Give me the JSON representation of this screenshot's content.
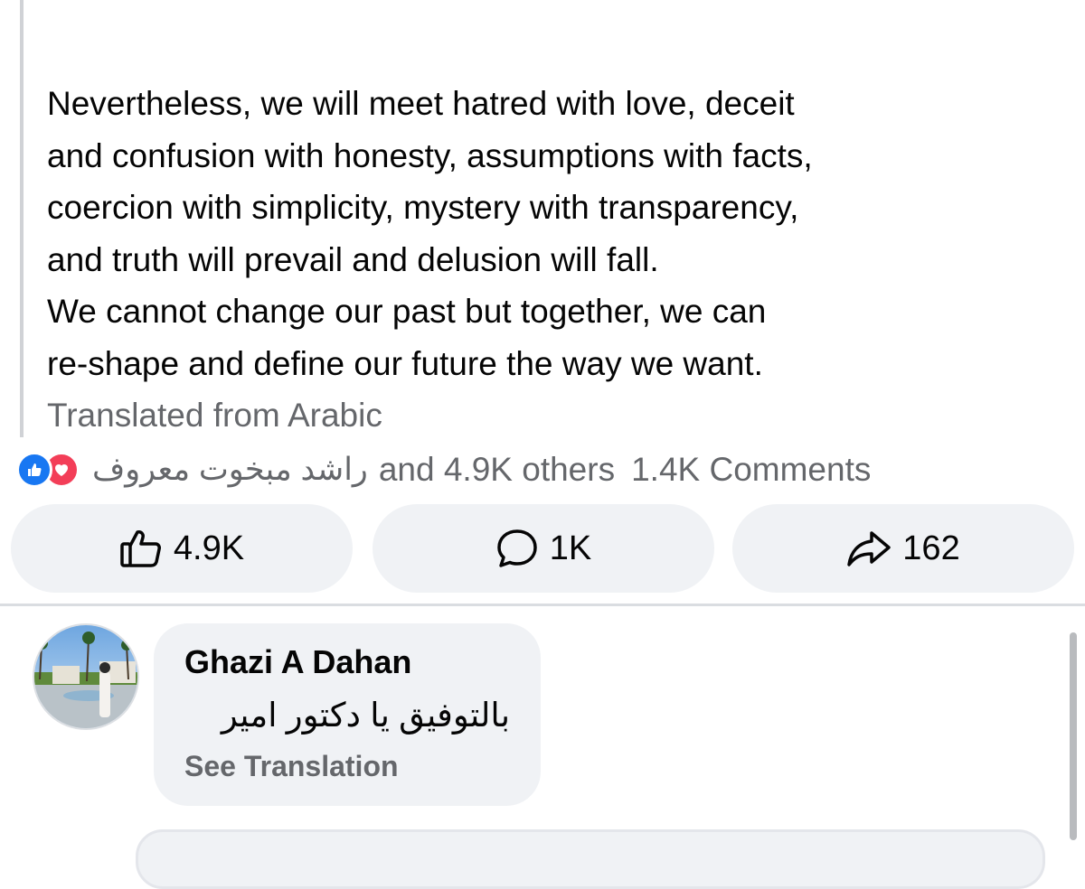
{
  "post": {
    "top_fragment": "·                                                  ·",
    "lines": [
      "Nevertheless, we will meet hatred with love, deceit",
      "and confusion with honesty, assumptions with facts,",
      "coercion with simplicity, mystery with transparency,",
      "and truth will prevail and delusion will fall.",
      "We cannot change our past but together, we can",
      "re-shape and define our future the way we want."
    ],
    "translated_label": "Translated from Arabic"
  },
  "reactions": {
    "icons": [
      "like-icon",
      "love-icon"
    ],
    "names": "راشد مبخوت معروف",
    "others": "and 4.9K others",
    "comments": "1.4K Comments"
  },
  "actions": {
    "like_count": "4.9K",
    "comment_count": "1K",
    "share_count": "162"
  },
  "comment": {
    "author": "Ghazi A Dahan",
    "text": "بالتوفيق يا دكتور امير",
    "see_translation": "See Translation"
  },
  "colors": {
    "like_blue": "#1877f2",
    "love_red": "#f33e58",
    "button_bg": "#f0f2f5",
    "secondary_text": "#65676b"
  }
}
